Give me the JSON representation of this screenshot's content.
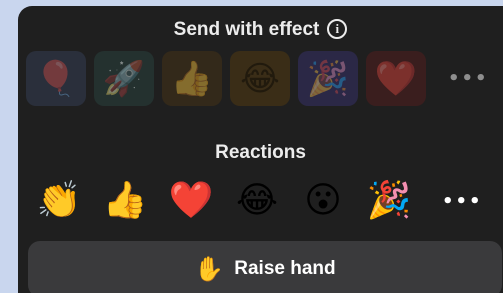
{
  "effects": {
    "title": "Send with effect",
    "info_icon": "info-circle-icon",
    "items": [
      {
        "name": "balloon",
        "glyph": "🎈"
      },
      {
        "name": "rocket",
        "glyph": "🚀"
      },
      {
        "name": "thumbs-up",
        "glyph": "👍"
      },
      {
        "name": "laughing",
        "glyph": "😂"
      },
      {
        "name": "party-popper",
        "glyph": "🎉"
      },
      {
        "name": "heart",
        "glyph": "❤️"
      }
    ],
    "more": "•••"
  },
  "reactions": {
    "title": "Reactions",
    "items": [
      {
        "name": "clap",
        "glyph": "👏"
      },
      {
        "name": "thumbs-up",
        "glyph": "👍"
      },
      {
        "name": "heart",
        "glyph": "❤️"
      },
      {
        "name": "laughing",
        "glyph": "😂"
      },
      {
        "name": "surprised",
        "glyph": "😮"
      },
      {
        "name": "party-popper",
        "glyph": "🎉"
      }
    ],
    "more": "•••"
  },
  "raise_hand": {
    "icon": "✋",
    "label": "Raise hand"
  },
  "colors": {
    "panel_background": "#1f1f1f",
    "tile_background": "#2c2c2e",
    "button_background": "#3a3a3c",
    "text": "#ffffff",
    "page_background": "#c9d6ee"
  }
}
